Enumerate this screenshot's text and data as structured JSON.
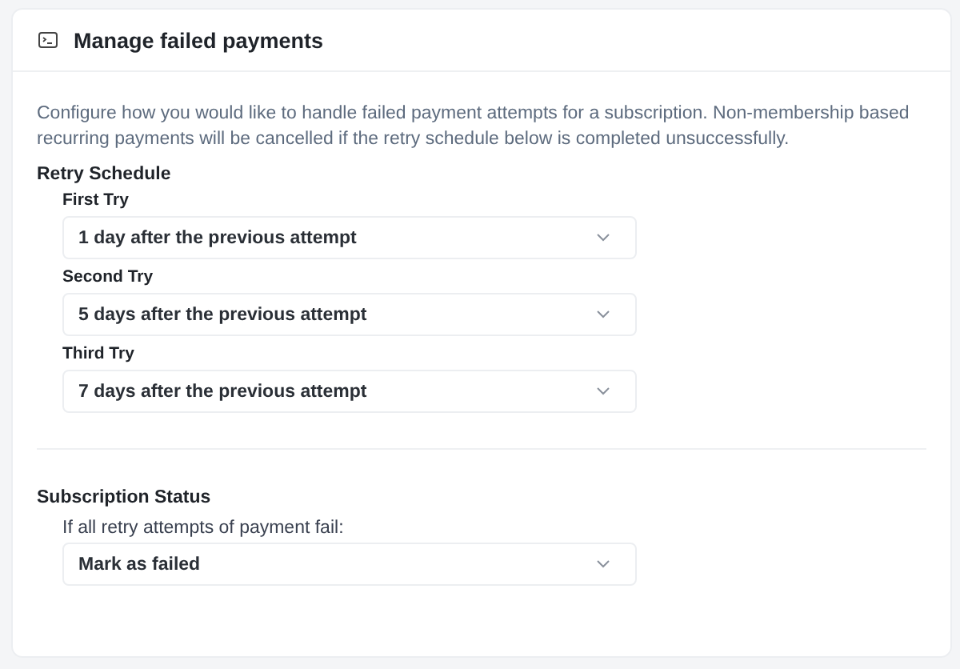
{
  "card": {
    "title": "Manage failed payments"
  },
  "description": "Configure how you would like to handle failed payment attempts for a subscription. Non-membership based recurring payments will be cancelled if the retry schedule below is completed unsuccessfully.",
  "sections": [
    {
      "heading": "Retry Schedule",
      "fields": [
        {
          "label": "First Try",
          "value": "1 day after the previous attempt"
        },
        {
          "label": "Second Try",
          "value": "5 days after the previous attempt"
        },
        {
          "label": "Third Try",
          "value": "7 days after the previous attempt"
        }
      ]
    },
    {
      "heading": "Subscription Status",
      "fields": [
        {
          "label": "If all retry attempts of payment fail:",
          "value": "Mark as failed"
        }
      ]
    }
  ]
}
